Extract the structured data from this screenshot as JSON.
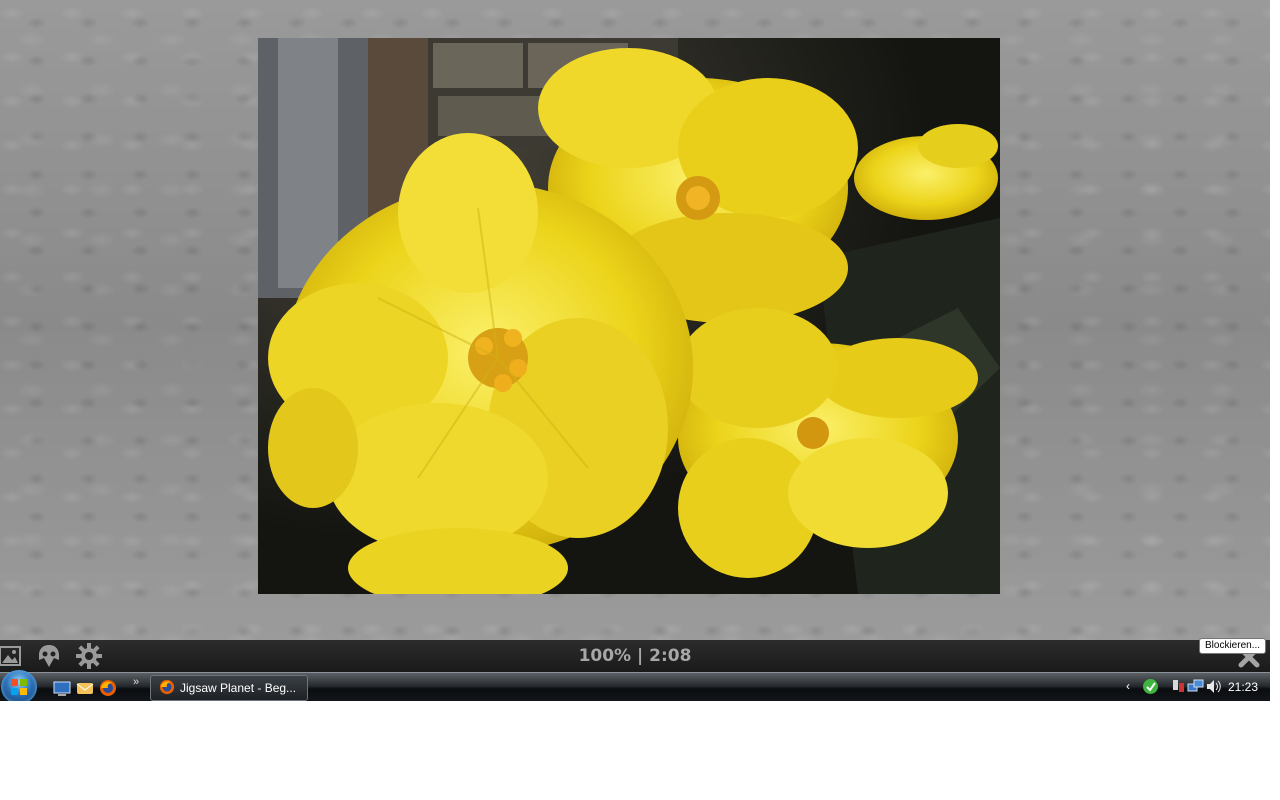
{
  "puzzle": {
    "image_subject": "yellow begonia flowers",
    "status_text": "100% | 2:08",
    "progress_percent": 100,
    "elapsed_time": "2:08",
    "toolbar_icons": [
      "picture-icon",
      "ghost-icon",
      "gear-icon"
    ],
    "close_icon": "close-icon"
  },
  "tooltip": {
    "text": "Blockieren..."
  },
  "taskbar": {
    "start_icon": "windows-start-icon",
    "quick_launch": [
      "show-desktop-icon",
      "mail-icon",
      "firefox-icon"
    ],
    "overflow_label": "»",
    "active_window": {
      "label": "Jigsaw Planet - Beg...",
      "icon": "firefox-icon"
    },
    "tray": {
      "collapse_arrow": "‹",
      "icons": [
        "messenger-icon",
        "safely-remove-icon",
        "network-icon",
        "volume-icon"
      ],
      "clock": "21:23"
    }
  }
}
